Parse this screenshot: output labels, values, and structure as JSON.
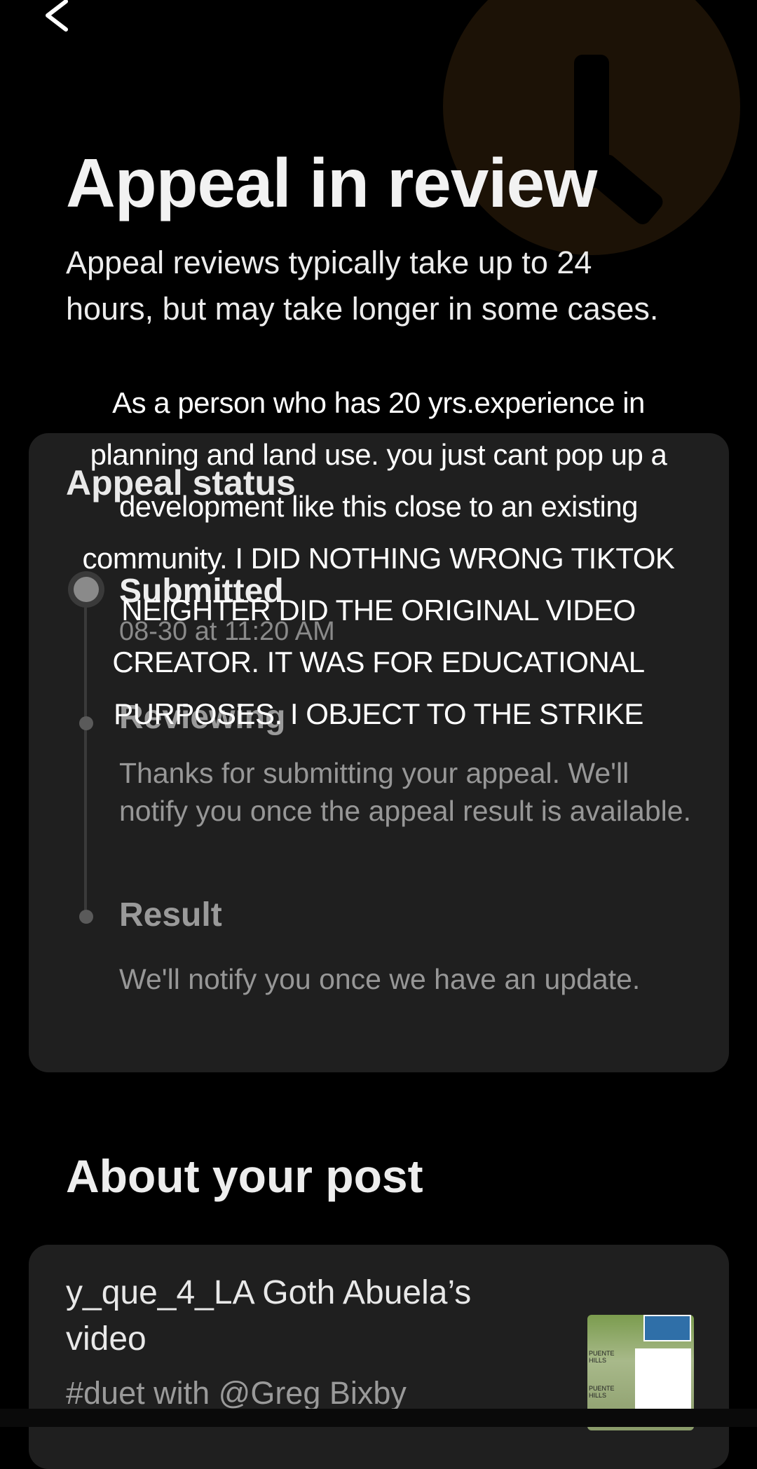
{
  "header": {
    "back_icon": "chevron-left-icon",
    "decoration_icon": "clock-icon"
  },
  "page": {
    "title": "Appeal in review",
    "subtitle": "Appeal reviews typically take up to 24 hours, but may take longer in some cases."
  },
  "status": {
    "title": "Appeal status",
    "steps": [
      {
        "label": "Submitted",
        "date": "08-30 at 11:20 AM",
        "description": ""
      },
      {
        "label": "Reviewing",
        "date": "",
        "description": "Thanks for submitting your appeal. We'll notify you once the appeal result is available."
      },
      {
        "label": "Result",
        "date": "",
        "description": "We'll notify you once we have an update."
      }
    ]
  },
  "overlay": {
    "lines": [
      "As a person who has 20 yrs.experience in",
      "planning and land use. you just cant pop up a",
      "development like this close to an existing",
      "community. I DID NOTHING WRONG TIKTOK",
      "NEIGHTER DID THE ORIGINAL VIDEO",
      "CREATOR. IT WAS FOR EDUCATIONAL",
      "PURPOSES. I OBJECT TO THE STRIKE"
    ]
  },
  "post": {
    "section_title": "About your post",
    "author": "y_que_4_LA Goth Abuela’s video",
    "caption": "#duet with @Greg Bixby",
    "thumbnail_label": "PUENTE HILLS"
  },
  "colors": {
    "background": "#000000",
    "card": "#1f1f1f",
    "muted_text": "#979797",
    "clock_decoration": "#1c1206"
  }
}
